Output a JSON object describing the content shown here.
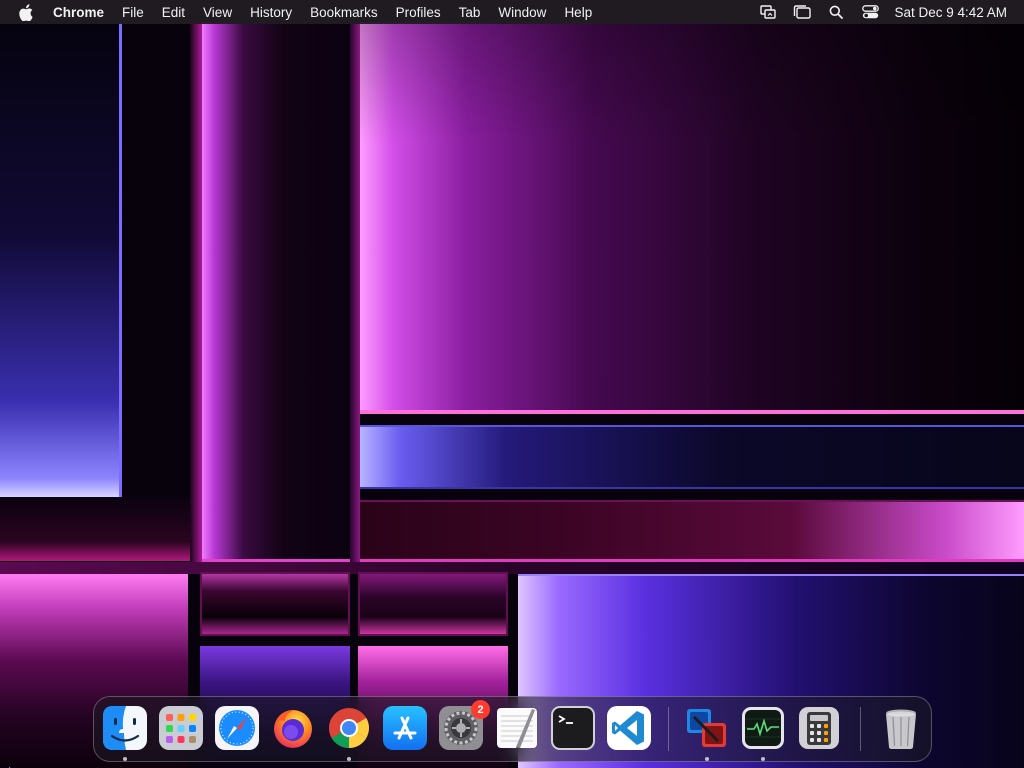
{
  "menubar": {
    "apple_icon": "apple-logo-icon",
    "app_name": "Chrome",
    "items": [
      "File",
      "Edit",
      "View",
      "History",
      "Bookmarks",
      "Profiles",
      "Tab",
      "Window",
      "Help"
    ],
    "status_icons": [
      "screen-mirroring-icon",
      "stage-manager-icon",
      "spotlight-search-icon",
      "control-center-icon"
    ],
    "clock": "Sat Dec 9  4:42 AM"
  },
  "dock": {
    "apps": [
      {
        "name": "Finder",
        "icon": "finder-icon",
        "running": true
      },
      {
        "name": "Launchpad",
        "icon": "launchpad-icon",
        "running": false
      },
      {
        "name": "Safari",
        "icon": "safari-icon",
        "running": false
      },
      {
        "name": "Firefox",
        "icon": "firefox-icon",
        "running": false
      },
      {
        "name": "Google Chrome",
        "icon": "chrome-icon",
        "running": true
      },
      {
        "name": "App Store",
        "icon": "app-store-icon",
        "running": false
      },
      {
        "name": "System Settings",
        "icon": "system-settings-icon",
        "running": false,
        "badge": "2"
      },
      {
        "name": "TextEdit",
        "icon": "textedit-icon",
        "running": false
      },
      {
        "name": "Terminal",
        "icon": "terminal-icon",
        "running": false
      },
      {
        "name": "Visual Studio Code",
        "icon": "vscode-icon",
        "running": false
      },
      {
        "name": "VMware Fusion",
        "icon": "vmware-fusion-icon",
        "running": true
      },
      {
        "name": "Activity Monitor",
        "icon": "activity-monitor-icon",
        "running": true
      },
      {
        "name": "Calculator",
        "icon": "calculator-icon",
        "running": false
      },
      {
        "name": "Trash",
        "icon": "trash-icon",
        "running": false
      }
    ]
  },
  "colors": {
    "menubar_bg": "#201c22",
    "badge": "#ff3b30",
    "wallpaper_accent_pink": "#ff6fdc",
    "wallpaper_accent_violet": "#7b6cff"
  }
}
